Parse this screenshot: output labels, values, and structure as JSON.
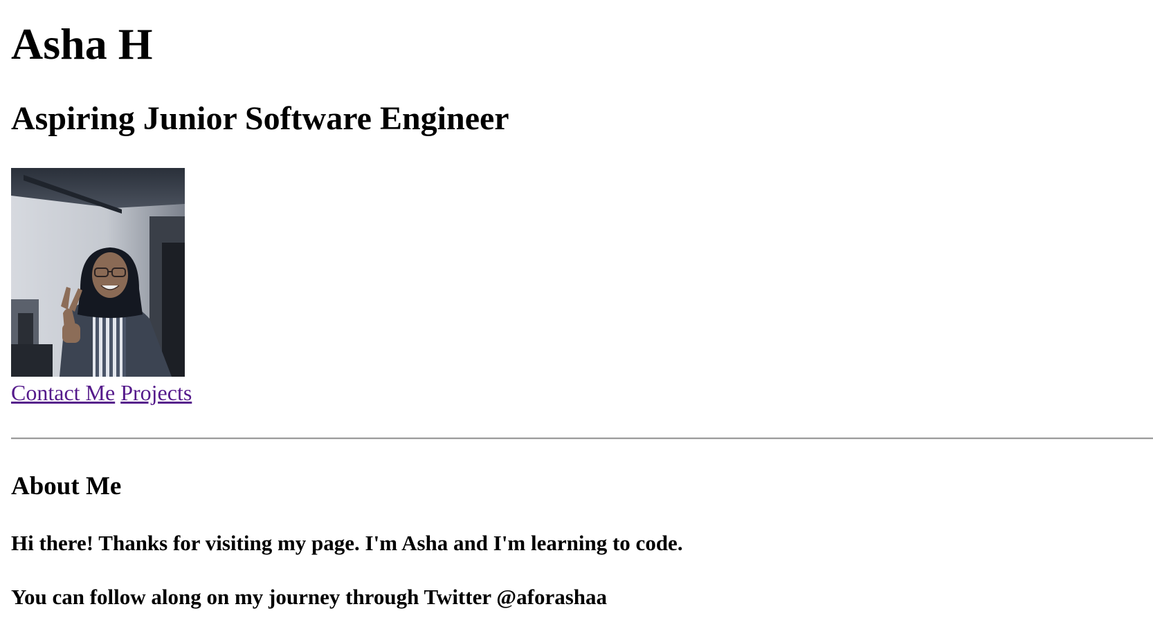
{
  "header": {
    "name": "Asha H",
    "tagline": "Aspiring Junior Software Engineer"
  },
  "profile_photo": {
    "alt": "Asha H"
  },
  "nav": {
    "contact_label": "Contact Me",
    "projects_label": "Projects"
  },
  "about": {
    "heading": "About Me",
    "line1": "Hi there! Thanks for visiting my page. I'm Asha and I'm learning to code.",
    "line2": "You can follow along on my journey through Twitter @aforashaa"
  },
  "colors": {
    "link_visited": "#551a8b",
    "text": "#000000",
    "background": "#ffffff"
  }
}
